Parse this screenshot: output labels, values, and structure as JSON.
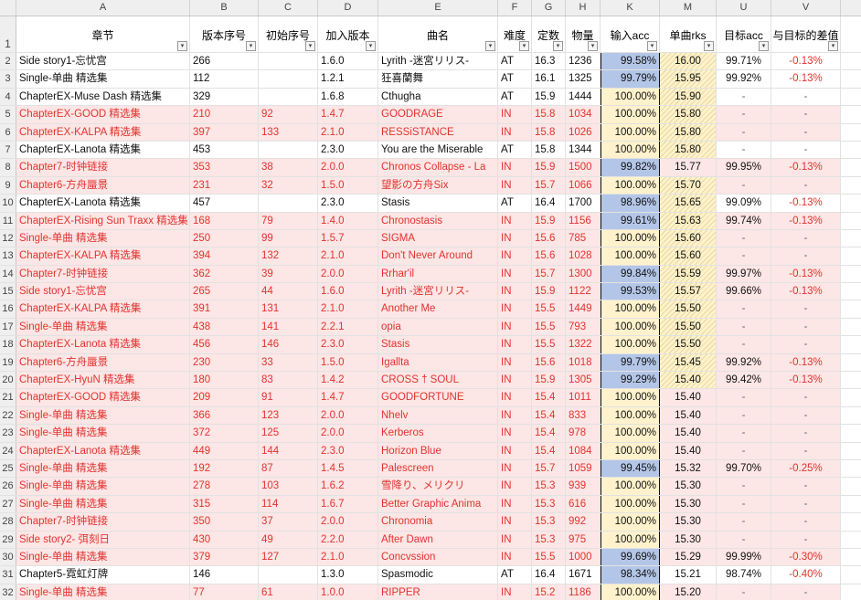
{
  "columns": [
    "",
    "A",
    "B",
    "C",
    "D",
    "E",
    "F",
    "G",
    "H",
    "K",
    "M",
    "U",
    "V"
  ],
  "headers": [
    "章节",
    "版本序号",
    "初始序号",
    "加入版本",
    "曲名",
    "难度",
    "定数",
    "物量",
    "输入acc",
    "单曲rks",
    "目标acc",
    "与目标的差值"
  ],
  "filter_symbol": "▾",
  "rows": [
    {
      "n": "2",
      "c": "white",
      "a": "Side story1-忘忧宫",
      "b": "266",
      "ci": "",
      "d": "1.6.0",
      "e": "Lyrith -迷宮リリス-",
      "f": "AT",
      "g": "16.3",
      "h": "1236",
      "k": "99.58%",
      "kb": "blue",
      "m": "16.00",
      "mh": true,
      "u": "99.71%",
      "v": "-0.13%"
    },
    {
      "n": "3",
      "c": "white",
      "a": "Single-单曲 精选集",
      "b": "112",
      "ci": "",
      "d": "1.2.1",
      "e": "狂喜蘭舞",
      "f": "AT",
      "g": "16.1",
      "h": "1325",
      "k": "99.79%",
      "kb": "blue",
      "m": "15.95",
      "mh": true,
      "u": "99.92%",
      "v": "-0.13%"
    },
    {
      "n": "4",
      "c": "white",
      "a": "ChapterEX-Muse Dash 精选集",
      "b": "329",
      "ci": "",
      "d": "1.6.8",
      "e": "Cthugha",
      "f": "AT",
      "g": "15.9",
      "h": "1444",
      "k": "100.00%",
      "kb": "yellow",
      "m": "15.90",
      "mh": true,
      "u": "-",
      "v": "-"
    },
    {
      "n": "5",
      "c": "red",
      "a": "ChapterEX-GOOD 精选集",
      "b": "210",
      "ci": "92",
      "d": "1.4.7",
      "e": "GOODRAGE",
      "f": "IN",
      "g": "15.8",
      "h": "1034",
      "k": "100.00%",
      "kb": "yellow",
      "m": "15.80",
      "mh": true,
      "u": "-",
      "v": "-"
    },
    {
      "n": "6",
      "c": "red",
      "a": "ChapterEX-KALPA 精选集",
      "b": "397",
      "ci": "133",
      "d": "2.1.0",
      "e": "RESSiSTANCE",
      "f": "IN",
      "g": "15.8",
      "h": "1026",
      "k": "100.00%",
      "kb": "yellow",
      "m": "15.80",
      "mh": true,
      "u": "-",
      "v": "-"
    },
    {
      "n": "7",
      "c": "white",
      "a": "ChapterEX-Lanota 精选集",
      "b": "453",
      "ci": "",
      "d": "2.3.0",
      "e": "You are the Miserable",
      "f": "AT",
      "g": "15.8",
      "h": "1344",
      "k": "100.00%",
      "kb": "yellow",
      "m": "15.80",
      "mh": true,
      "u": "-",
      "v": "-"
    },
    {
      "n": "8",
      "c": "red",
      "a": "Chapter7-时钟链接",
      "b": "353",
      "ci": "38",
      "d": "2.0.0",
      "e": "Chronos Collapse - La",
      "f": "IN",
      "g": "15.9",
      "h": "1500",
      "k": "99.82%",
      "kb": "blue",
      "m": "15.77",
      "mh": false,
      "u": "99.95%",
      "v": "-0.13%"
    },
    {
      "n": "9",
      "c": "red",
      "a": "Chapter6-方舟蜃景",
      "b": "231",
      "ci": "32",
      "d": "1.5.0",
      "e": "望影の方舟Six",
      "f": "IN",
      "g": "15.7",
      "h": "1066",
      "k": "100.00%",
      "kb": "yellow",
      "m": "15.70",
      "mh": true,
      "u": "-",
      "v": "-"
    },
    {
      "n": "10",
      "c": "white",
      "a": "ChapterEX-Lanota 精选集",
      "b": "457",
      "ci": "",
      "d": "2.3.0",
      "e": "Stasis",
      "f": "AT",
      "g": "16.4",
      "h": "1700",
      "k": "98.96%",
      "kb": "blue",
      "m": "15.65",
      "mh": true,
      "u": "99.09%",
      "v": "-0.13%"
    },
    {
      "n": "11",
      "c": "red",
      "a": "ChapterEX-Rising Sun Traxx 精选集",
      "b": "168",
      "ci": "79",
      "d": "1.4.0",
      "e": "Chronostasis",
      "f": "IN",
      "g": "15.9",
      "h": "1156",
      "k": "99.61%",
      "kb": "blue",
      "m": "15.63",
      "mh": true,
      "u": "99.74%",
      "v": "-0.13%"
    },
    {
      "n": "12",
      "c": "red",
      "a": "Single-单曲 精选集",
      "b": "250",
      "ci": "99",
      "d": "1.5.7",
      "e": "SIGMA",
      "f": "IN",
      "g": "15.6",
      "h": "785",
      "k": "100.00%",
      "kb": "yellow",
      "m": "15.60",
      "mh": true,
      "u": "-",
      "v": "-"
    },
    {
      "n": "13",
      "c": "red",
      "a": "ChapterEX-KALPA 精选集",
      "b": "394",
      "ci": "132",
      "d": "2.1.0",
      "e": "Don't Never Around",
      "f": "IN",
      "g": "15.6",
      "h": "1028",
      "k": "100.00%",
      "kb": "yellow",
      "m": "15.60",
      "mh": true,
      "u": "-",
      "v": "-"
    },
    {
      "n": "14",
      "c": "red",
      "a": "Chapter7-时钟链接",
      "b": "362",
      "ci": "39",
      "d": "2.0.0",
      "e": "Rrhar'il",
      "f": "IN",
      "g": "15.7",
      "h": "1300",
      "k": "99.84%",
      "kb": "blue",
      "m": "15.59",
      "mh": true,
      "u": "99.97%",
      "v": "-0.13%"
    },
    {
      "n": "15",
      "c": "red",
      "a": "Side story1-忘忧宫",
      "b": "265",
      "ci": "44",
      "d": "1.6.0",
      "e": "Lyrith -迷宮リリス-",
      "f": "IN",
      "g": "15.9",
      "h": "1122",
      "k": "99.53%",
      "kb": "blue",
      "m": "15.57",
      "mh": true,
      "u": "99.66%",
      "v": "-0.13%"
    },
    {
      "n": "16",
      "c": "red",
      "a": "ChapterEX-KALPA 精选集",
      "b": "391",
      "ci": "131",
      "d": "2.1.0",
      "e": "Another Me",
      "f": "IN",
      "g": "15.5",
      "h": "1449",
      "k": "100.00%",
      "kb": "yellow",
      "m": "15.50",
      "mh": true,
      "u": "-",
      "v": "-"
    },
    {
      "n": "17",
      "c": "red",
      "a": "Single-单曲 精选集",
      "b": "438",
      "ci": "141",
      "d": "2.2.1",
      "e": "opia",
      "f": "IN",
      "g": "15.5",
      "h": "793",
      "k": "100.00%",
      "kb": "yellow",
      "m": "15.50",
      "mh": true,
      "u": "-",
      "v": "-"
    },
    {
      "n": "18",
      "c": "red",
      "a": "ChapterEX-Lanota 精选集",
      "b": "456",
      "ci": "146",
      "d": "2.3.0",
      "e": "Stasis",
      "f": "IN",
      "g": "15.5",
      "h": "1322",
      "k": "100.00%",
      "kb": "yellow",
      "m": "15.50",
      "mh": true,
      "u": "-",
      "v": "-"
    },
    {
      "n": "19",
      "c": "red",
      "a": "Chapter6-方舟蜃景",
      "b": "230",
      "ci": "33",
      "d": "1.5.0",
      "e": "Igallta",
      "f": "IN",
      "g": "15.6",
      "h": "1018",
      "k": "99.79%",
      "kb": "blue",
      "m": "15.45",
      "mh": true,
      "u": "99.92%",
      "v": "-0.13%"
    },
    {
      "n": "20",
      "c": "red",
      "a": "ChapterEX-HyuN 精选集",
      "b": "180",
      "ci": "83",
      "d": "1.4.2",
      "e": "CROSS † SOUL",
      "f": "IN",
      "g": "15.9",
      "h": "1305",
      "k": "99.29%",
      "kb": "blue",
      "m": "15.40",
      "mh": true,
      "u": "99.42%",
      "v": "-0.13%"
    },
    {
      "n": "21",
      "c": "red",
      "a": "ChapterEX-GOOD 精选集",
      "b": "209",
      "ci": "91",
      "d": "1.4.7",
      "e": "GOODFORTUNE",
      "f": "IN",
      "g": "15.4",
      "h": "1011",
      "k": "100.00%",
      "kb": "yellow",
      "m": "15.40",
      "mh": false,
      "u": "-",
      "v": "-"
    },
    {
      "n": "22",
      "c": "red",
      "a": "Single-单曲 精选集",
      "b": "366",
      "ci": "123",
      "d": "2.0.0",
      "e": "Nhelv",
      "f": "IN",
      "g": "15.4",
      "h": "833",
      "k": "100.00%",
      "kb": "yellow",
      "m": "15.40",
      "mh": false,
      "u": "-",
      "v": "-"
    },
    {
      "n": "23",
      "c": "red",
      "a": "Single-单曲 精选集",
      "b": "372",
      "ci": "125",
      "d": "2.0.0",
      "e": "Kerberos",
      "f": "IN",
      "g": "15.4",
      "h": "978",
      "k": "100.00%",
      "kb": "yellow",
      "m": "15.40",
      "mh": false,
      "u": "-",
      "v": "-"
    },
    {
      "n": "24",
      "c": "red",
      "a": "ChapterEX-Lanota 精选集",
      "b": "449",
      "ci": "144",
      "d": "2.3.0",
      "e": "Horizon Blue",
      "f": "IN",
      "g": "15.4",
      "h": "1084",
      "k": "100.00%",
      "kb": "yellow",
      "m": "15.40",
      "mh": false,
      "u": "-",
      "v": "-"
    },
    {
      "n": "25",
      "c": "red",
      "a": "Single-单曲 精选集",
      "b": "192",
      "ci": "87",
      "d": "1.4.5",
      "e": "Palescreen",
      "f": "IN",
      "g": "15.7",
      "h": "1059",
      "k": "99.45%",
      "kb": "blue",
      "m": "15.32",
      "mh": false,
      "u": "99.70%",
      "v": "-0.25%"
    },
    {
      "n": "26",
      "c": "red",
      "a": "Single-单曲 精选集",
      "b": "278",
      "ci": "103",
      "d": "1.6.2",
      "e": "雪降り、メリクリ",
      "f": "IN",
      "g": "15.3",
      "h": "939",
      "k": "100.00%",
      "kb": "yellow",
      "m": "15.30",
      "mh": false,
      "u": "-",
      "v": "-"
    },
    {
      "n": "27",
      "c": "red",
      "a": "Single-单曲 精选集",
      "b": "315",
      "ci": "114",
      "d": "1.6.7",
      "e": "Better Graphic Anima",
      "f": "IN",
      "g": "15.3",
      "h": "616",
      "k": "100.00%",
      "kb": "yellow",
      "m": "15.30",
      "mh": false,
      "u": "-",
      "v": "-"
    },
    {
      "n": "28",
      "c": "red",
      "a": "Chapter7-时钟链接",
      "b": "350",
      "ci": "37",
      "d": "2.0.0",
      "e": "Chronomia",
      "f": "IN",
      "g": "15.3",
      "h": "992",
      "k": "100.00%",
      "kb": "yellow",
      "m": "15.30",
      "mh": false,
      "u": "-",
      "v": "-"
    },
    {
      "n": "29",
      "c": "red",
      "a": "Side story2- 弭刻日",
      "b": "430",
      "ci": "49",
      "d": "2.2.0",
      "e": "After Dawn",
      "f": "IN",
      "g": "15.3",
      "h": "975",
      "k": "100.00%",
      "kb": "yellow",
      "m": "15.30",
      "mh": false,
      "u": "-",
      "v": "-"
    },
    {
      "n": "30",
      "c": "red",
      "a": "Single-单曲 精选集",
      "b": "379",
      "ci": "127",
      "d": "2.1.0",
      "e": "Concvssion",
      "f": "IN",
      "g": "15.5",
      "h": "1000",
      "k": "99.69%",
      "kb": "blue",
      "m": "15.29",
      "mh": false,
      "u": "99.99%",
      "v": "-0.30%"
    },
    {
      "n": "31",
      "c": "white",
      "a": "Chapter5-霓虹灯牌",
      "b": "146",
      "ci": "",
      "d": "1.3.0",
      "e": "Spasmodic",
      "f": "AT",
      "g": "16.4",
      "h": "1671",
      "k": "98.34%",
      "kb": "blue",
      "m": "15.21",
      "mh": false,
      "u": "98.74%",
      "v": "-0.40%"
    },
    {
      "n": "32",
      "c": "red",
      "a": "Single-单曲 精选集",
      "b": "77",
      "ci": "61",
      "d": "1.0.0",
      "e": "RIPPER",
      "f": "IN",
      "g": "15.2",
      "h": "1186",
      "k": "100.00%",
      "kb": "yellow",
      "m": "15.20",
      "mh": false,
      "u": "-",
      "v": "-"
    }
  ]
}
